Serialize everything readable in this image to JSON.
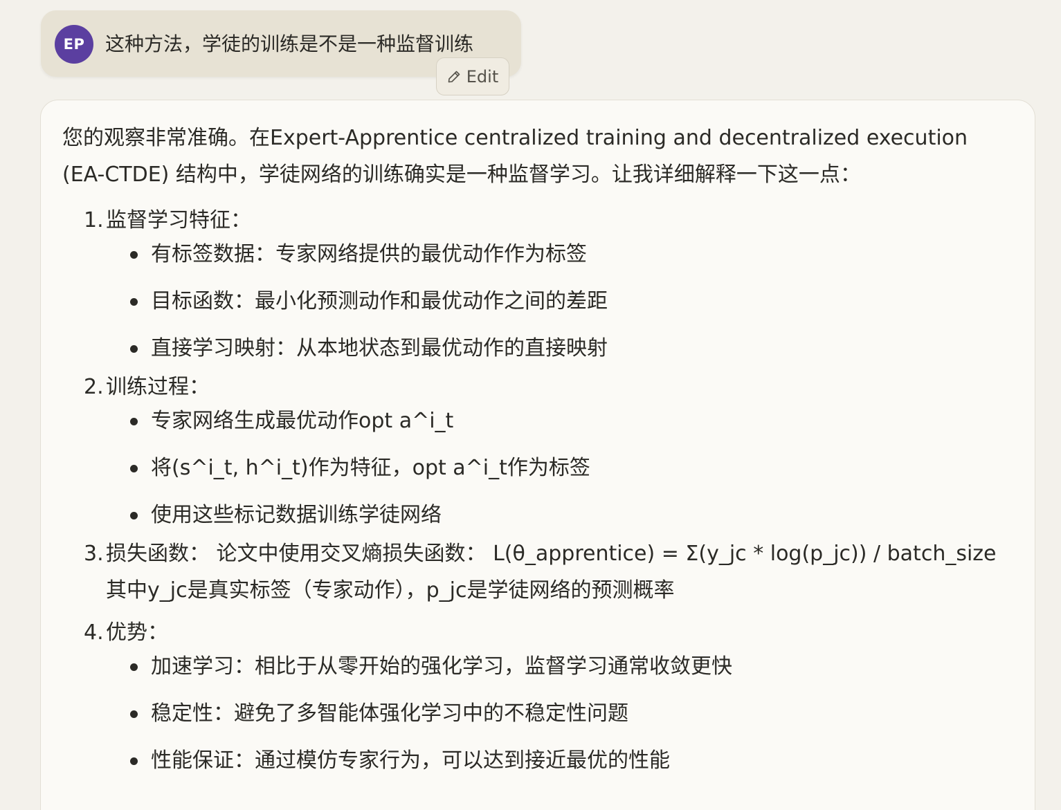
{
  "user_message": {
    "avatar_initials": "EP",
    "text": "这种方法，学徒的训练是不是一种监督训练",
    "edit_label": "Edit"
  },
  "assistant": {
    "intro": "您的观察非常准确。在Expert-Apprentice centralized training and decentralized execution (EA-CTDE) 结构中，学徒网络的训练确实是一种监督学习。让我详细解释一下这一点：",
    "sections": [
      {
        "number": "1.",
        "title": "监督学习特征：",
        "bullets": [
          "有标签数据：专家网络提供的最优动作作为标签",
          "目标函数：最小化预测动作和最优动作之间的差距",
          "直接学习映射：从本地状态到最优动作的直接映射"
        ]
      },
      {
        "number": "2.",
        "title": "训练过程：",
        "bullets": [
          "专家网络生成最优动作opt a^i_t",
          "将(s^i_t, h^i_t)作为特征，opt a^i_t作为标签",
          "使用这些标记数据训练学徒网络"
        ]
      },
      {
        "number": "3.",
        "text": "损失函数： 论文中使用交叉熵损失函数： L(θ_apprentice) = Σ(y_jc * log(p_jc)) / batch_size 其中y_jc是真实标签（专家动作），p_jc是学徒网络的预测概率"
      },
      {
        "number": "4.",
        "title": "优势：",
        "bullets": [
          "加速学习：相比于从零开始的强化学习，监督学习通常收敛更快",
          "稳定性：避免了多智能体强化学习中的不稳定性问题",
          "性能保证：通过模仿专家行为，可以达到接近最优的性能"
        ]
      }
    ]
  },
  "colors": {
    "background": "#f3f1eb",
    "user_bubble": "#e7e2d4",
    "avatar": "#5b3fa0",
    "card": "#fbfaf6",
    "text": "#2b2a26"
  },
  "icons": {
    "edit": "pencil-icon"
  }
}
